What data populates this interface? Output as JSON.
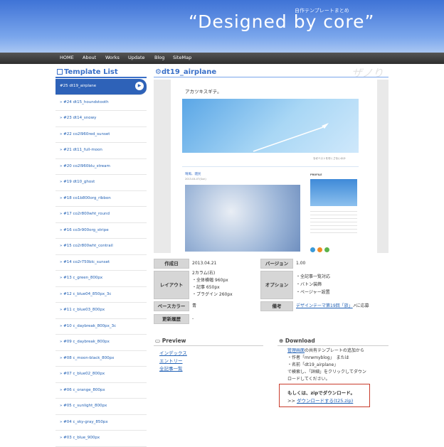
{
  "header": {
    "title": "“Designed by core”",
    "subtitle": "自作テンプレートまとめ"
  },
  "nav": {
    "items": [
      {
        "label": "HOME"
      },
      {
        "label": "About"
      },
      {
        "label": "Works"
      },
      {
        "label": "Update"
      },
      {
        "label": "Blog"
      },
      {
        "label": "SiteMap"
      }
    ]
  },
  "sidebar": {
    "title": "Template List",
    "items": [
      {
        "label": "#25 dt19_airplane"
      },
      {
        "label": "» #24 dt15_houndstooth"
      },
      {
        "label": "» #23 dt14_snowy"
      },
      {
        "label": "» #22 co2l960red_sunset"
      },
      {
        "label": "» #21 dt11_full-moon"
      },
      {
        "label": "» #20 co2l960blu_stream"
      },
      {
        "label": "» #19 dt10_ghost"
      },
      {
        "label": "» #18 co1b800org_ribbon"
      },
      {
        "label": "» #17 co2r800wht_round"
      },
      {
        "label": "» #16 co3r900org_stripe"
      },
      {
        "label": "» #15 co2r800wht_contrail"
      },
      {
        "label": "» #14 co2r750blc_sunset"
      },
      {
        "label": "» #13 c_green_800px"
      },
      {
        "label": "» #12 c_blue04_850px_3c"
      },
      {
        "label": "» #11 c_blue03_800px"
      },
      {
        "label": "» #10 c_daybreak_800px_3c"
      },
      {
        "label": "» #09 c_daybreak_800px"
      },
      {
        "label": "» #08 c_moon-black_800px"
      },
      {
        "label": "» #07 c_blue02_800px"
      },
      {
        "label": "» #06 c_orange_800px"
      },
      {
        "label": "» #05 c_sunlight_800px"
      },
      {
        "label": "» #04 c_sky-gray_850px"
      },
      {
        "label": "» #03 c_blue_900px"
      }
    ],
    "active_arrow": "▶"
  },
  "main": {
    "title": "dt19_airplane",
    "deco_text": "ザノり",
    "preview": {
      "blog_title": "アカツキスギテ。",
      "caption": "なぜベストを尽くさないのか",
      "post_title": "晴風、雑民",
      "post_date": "2013-04-07(Sun)",
      "profile_label": "PROFILE"
    }
  },
  "info": {
    "created_label": "作成日",
    "created_value": "2013.04.21",
    "version_label": "バージョン",
    "version_value": "1.00",
    "layout_label": "レイアウト",
    "layout_lines": [
      "2カラム(右)",
      "・全体横幅 960px",
      "・記事 650px",
      "・プラグイン 260px"
    ],
    "option_label": "オプション",
    "option_lines": [
      "・全記事一覧対応",
      "・バトン装飾",
      "・ページャー設置"
    ],
    "basecolor_label": "ベースカラー",
    "basecolor_value": "青",
    "note_label": "備考",
    "note_link": "デザインテーマ第19回「旅」",
    "note_suffix": "に応募",
    "history_label": "更新履歴",
    "history_value": "-"
  },
  "preview_section": {
    "title": "Preview",
    "links": [
      "インデックス",
      "エントリー",
      "全記事一覧"
    ]
  },
  "download_section": {
    "title": "Download",
    "text_link": "管理画面",
    "text_lines": [
      "の共有テンプレートの追加から",
      "・作者「mrwmyblog」　または",
      "・名前「dt19_airplane」",
      "で検索し、「詳細」をクリックしてダウン",
      "ロードしてください。"
    ],
    "box_line1": "もしくは、zipでダウンロード。",
    "box_prefix": ">>",
    "box_link": "ダウンロードする(t25.zip)"
  },
  "colors": {
    "accent": "#3a70c8",
    "header_top": "#3f73d6",
    "nav_bg": "#2e2e2e",
    "download_border": "#c93c2c"
  }
}
